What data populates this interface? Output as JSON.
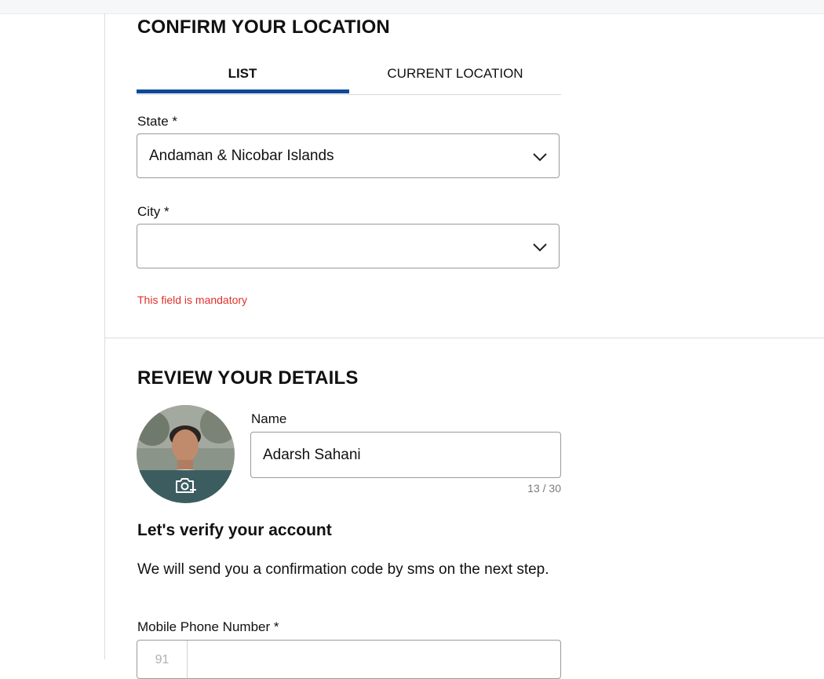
{
  "location": {
    "title": "CONFIRM YOUR LOCATION",
    "tabs": [
      {
        "label": "LIST",
        "active": true
      },
      {
        "label": "CURRENT LOCATION",
        "active": false
      }
    ],
    "state": {
      "label": "State *",
      "value": "Andaman & Nicobar Islands"
    },
    "city": {
      "label": "City *",
      "value": ""
    },
    "error": "This field is mandatory"
  },
  "details": {
    "title": "REVIEW YOUR DETAILS",
    "name": {
      "label": "Name",
      "value": "Adarsh Sahani",
      "counter": "13 / 30"
    },
    "verify_title": "Let's verify your account",
    "verify_text": "We will send you a confirmation code by sms on the next step.",
    "phone": {
      "label": "Mobile Phone Number *",
      "prefix": "91"
    }
  },
  "colors": {
    "accent": "#0b4a9b",
    "error": "#e0312a",
    "avatar_band": "#3c5d60"
  },
  "icons": {
    "dropdown": "chevron-down-icon",
    "camera": "camera-add-icon"
  }
}
